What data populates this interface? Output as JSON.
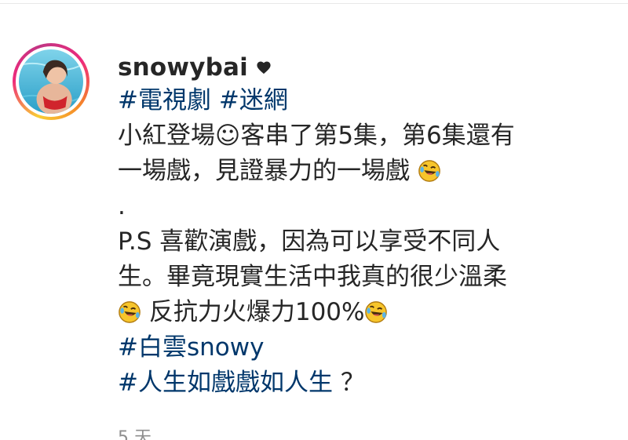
{
  "post": {
    "username": "snowybai",
    "heart_icon": "heart-icon",
    "hashtags_line1": [
      "#電視劇",
      "#迷網"
    ],
    "line2_text": "小紅登場☺客串了第5集，第6集還有",
    "line3_text": "一場戲，見證暴力的一場戲",
    "dot": ".",
    "line5_text": "P.S 喜歡演戲，因為可以享受不同人",
    "line6_text": "生。畢竟現實生活中我真的很少溫柔",
    "line7_text": " 反抗力火爆力100%",
    "hashtag_snowy": "#白雲snowy",
    "hashtag_last": "#人生如戲戲如人生",
    "last_suffix": "？",
    "emoji_icon": "rolling-laughing-icon",
    "time_ago": "5 天"
  },
  "colors": {
    "hashtag": "#00376b",
    "text": "#262626",
    "muted": "#8e8e8e"
  }
}
